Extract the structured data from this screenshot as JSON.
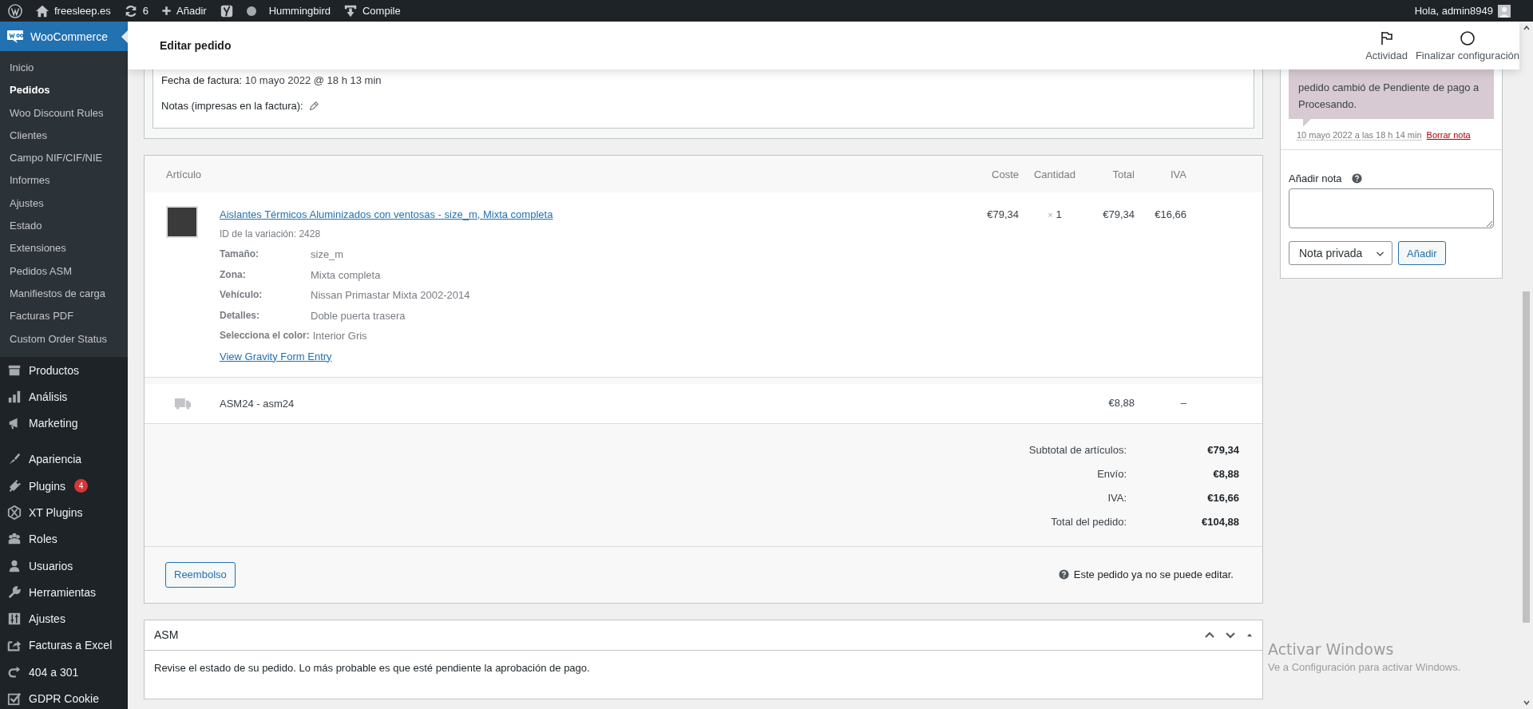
{
  "admin_bar": {
    "site": "freesleep.es",
    "updates": "6",
    "new": "Añadir",
    "hummingbird": "Hummingbird",
    "compile": "Compile",
    "greeting": "Hola, admin8949"
  },
  "sidebar": {
    "current": "WooCommerce",
    "submenu": [
      {
        "label": "Inicio",
        "selected": false
      },
      {
        "label": "Pedidos",
        "selected": true
      },
      {
        "label": "Woo Discount Rules",
        "selected": false
      },
      {
        "label": "Clientes",
        "selected": false
      },
      {
        "label": "Campo NIF/CIF/NIE",
        "selected": false
      },
      {
        "label": "Informes",
        "selected": false
      },
      {
        "label": "Ajustes",
        "selected": false
      },
      {
        "label": "Estado",
        "selected": false
      },
      {
        "label": "Extensiones",
        "selected": false
      },
      {
        "label": "Pedidos ASM",
        "selected": false
      },
      {
        "label": "Manifiestos de carga",
        "selected": false
      },
      {
        "label": "Facturas PDF",
        "selected": false
      },
      {
        "label": "Custom Order Status",
        "selected": false
      }
    ],
    "menu_groups": [
      {
        "items": [
          {
            "label": "Productos"
          },
          {
            "label": "Análisis"
          },
          {
            "label": "Marketing"
          }
        ]
      },
      {
        "items": [
          {
            "label": "Apariencia"
          },
          {
            "label": "Plugins",
            "badge": "4"
          },
          {
            "label": "XT Plugins"
          },
          {
            "label": "Roles"
          },
          {
            "label": "Usuarios"
          },
          {
            "label": "Herramientas"
          },
          {
            "label": "Ajustes"
          },
          {
            "label": "Facturas a Excel"
          },
          {
            "label": "404 a 301"
          },
          {
            "label": "GDPR Cookie"
          }
        ]
      }
    ]
  },
  "header": {
    "title": "Editar pedido",
    "actions": [
      "Actividad",
      "Finalizar configuración"
    ]
  },
  "invoice": {
    "date_label": "Fecha de factura:",
    "date": "10 mayo 2022 @ 18 h 13 min",
    "notes_label": "Notas (impresas en la factura):"
  },
  "items": {
    "columns": [
      "Artículo",
      "Coste",
      "Cantidad",
      "Total",
      "IVA"
    ],
    "products": [
      {
        "name": "Aislantes Térmicos Aluminizados con ventosas - size_m, Mixta completa",
        "variation_label": "ID de la variación:",
        "variation_id": "2428",
        "meta": [
          {
            "label": "Tamaño:",
            "value": "size_m"
          },
          {
            "label": "Zona:",
            "value": "Mixta completa"
          },
          {
            "label": "Vehículo:",
            "value": "Nissan Primastar Mixta 2002-2014"
          },
          {
            "label": "Detalles:",
            "value": "Doble puerta trasera"
          },
          {
            "label": "Selecciona el color:",
            "value": "Interior Gris"
          }
        ],
        "link": "View Gravity Form Entry",
        "cost": "€79,34",
        "qty_mark": "×",
        "qty": "1",
        "total": "€79,34",
        "tax": "€16,66"
      }
    ],
    "shipping": {
      "name": "ASM24 - asm24",
      "total": "€8,88",
      "tax": "–"
    },
    "totals": [
      {
        "label": "Subtotal de artículos:",
        "value": "€79,34"
      },
      {
        "label": "Envío:",
        "value": "€8,88"
      },
      {
        "label": "IVA:",
        "value": "€16,66"
      },
      {
        "label": "Total del pedido:",
        "value": "€104,88"
      }
    ],
    "refund_button": "Reembolso",
    "notice": "Este pedido ya no se puede editar."
  },
  "asm": {
    "title": "ASM",
    "message": "Revise el estado de su pedido. Lo más probable es que esté pendiente la aprobación de pago."
  },
  "notes": {
    "note_text": "pedido cambió de Pendiente de pago a Procesando.",
    "date": "10 mayo 2022 a las 18 h 14 min",
    "delete": "Borrar nota",
    "add_label": "Añadir nota",
    "type": "Nota privada",
    "add_button": "Añadir"
  },
  "windows_notice": {
    "title": "Activar Windows",
    "text": "Ve a Configuración para activar Windows."
  }
}
